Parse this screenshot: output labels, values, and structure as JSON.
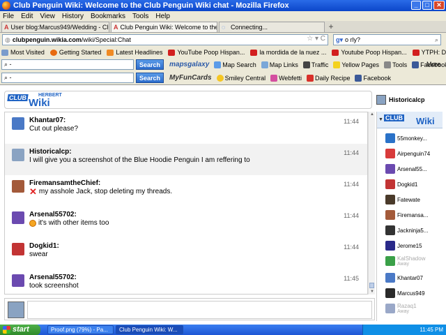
{
  "window": {
    "title": "Club Penguin Wiki: Welcome to the Club Penguin Wiki chat - Mozilla Firefox"
  },
  "menu": [
    "File",
    "Edit",
    "View",
    "History",
    "Bookmarks",
    "Tools",
    "Help"
  ],
  "tabs": [
    {
      "label": "User blog:Marcus949/Wedding - Club Pe...",
      "active": false
    },
    {
      "label": "Club Penguin Wiki: Welcome to the Club ...",
      "active": true
    },
    {
      "label": "Connecting...",
      "active": false
    }
  ],
  "nav": {
    "url_host": "clubpenguin.wikia.com",
    "url_path": "/wiki/Special:Chat",
    "search_value": "o rly?"
  },
  "bookmarks": [
    {
      "label": "Most Visited",
      "color": "#7a9ccc"
    },
    {
      "label": "Getting Started",
      "color": "#e86a10"
    },
    {
      "label": "Latest Headlines",
      "color": "#f08a24"
    },
    {
      "label": "YouTube Poop Hispan...",
      "color": "#d21f1f"
    },
    {
      "label": "la mordida de la nuez ...",
      "color": "#d21f1f"
    },
    {
      "label": "Youtube Poop Hispan...",
      "color": "#d21f1f"
    },
    {
      "label": "YTPH: Don Pendejo pi...",
      "color": "#d21f1f"
    }
  ],
  "toolbar1": {
    "search_button": "Search",
    "logo": "mapsgalaxy",
    "items": [
      "Map Search",
      "Map Links",
      "Traffic",
      "Yellow Pages",
      "Tools",
      "Facebook"
    ],
    "more": "More"
  },
  "toolbar2": {
    "search_button": "Search",
    "logo": "MyFunCards",
    "items": [
      "Smiley Central",
      "Webfetti",
      "Daily Recipe",
      "Facebook"
    ]
  },
  "chat": {
    "logo_club": "CLUB",
    "logo_herbert": "HERBERT",
    "logo_wiki": "Wiki",
    "current_user": "Historicalcp",
    "messages": [
      {
        "user": "Khantar07:",
        "text": "Cut out please?",
        "time": "11:44",
        "avatar_color": "#4a79c6",
        "emoji": ""
      },
      {
        "user": "Historicalcp:",
        "text": "I will give you a screenshot of the Blue Hoodie Penguin I am reffering to",
        "time": "11:44",
        "avatar_color": "#8aa3c2",
        "emoji": ""
      },
      {
        "user": "FiremansamtheChief:",
        "text": "my asshole Jack, stop deleting my threads.",
        "time": "11:44",
        "avatar_color": "#a35a3a",
        "emoji": "x"
      },
      {
        "user": "Arsenal55702:",
        "text": "it's with other items too",
        "time": "11:44",
        "avatar_color": "#6b4ab0",
        "emoji": "smile"
      },
      {
        "user": "Dogkid1:",
        "text": "swear",
        "time": "11:44",
        "avatar_color": "#c23434",
        "emoji": ""
      },
      {
        "user": "Arsenal55702:",
        "text": "took screenshot",
        "time": "11:45",
        "avatar_color": "#6b4ab0",
        "emoji": ""
      }
    ],
    "users": [
      {
        "name": "55monkey...",
        "color": "#2a72c8",
        "away": false
      },
      {
        "name": "Airpenguin74",
        "color": "#d83b3b",
        "away": false
      },
      {
        "name": "Arsenal55...",
        "color": "#6b4ab0",
        "away": false
      },
      {
        "name": "Dogkid1",
        "color": "#c23434",
        "away": false
      },
      {
        "name": "Fatewate",
        "color": "#4a3a2a",
        "away": false
      },
      {
        "name": "Firemansa...",
        "color": "#a35a3a",
        "away": false
      },
      {
        "name": "Jackninja5...",
        "color": "#333333",
        "away": false
      },
      {
        "name": "Jerome15",
        "color": "#2a2a8a",
        "away": false
      },
      {
        "name": "KalShadow",
        "color": "#3aa048",
        "away": true
      },
      {
        "name": "Khantar07",
        "color": "#4a79c6",
        "away": false
      },
      {
        "name": "Marcus949",
        "color": "#2a2a2a",
        "away": false
      },
      {
        "name": "Razaq1",
        "color": "#9aa8c8",
        "away": true
      }
    ],
    "away_label": "Away"
  },
  "taskbar": {
    "start": "start",
    "tasks": [
      {
        "label": "Proof.png (79%) - Pa...",
        "active": false
      },
      {
        "label": "Club Penguin Wiki: W...",
        "active": true
      }
    ],
    "clock": "11:45 PM"
  }
}
